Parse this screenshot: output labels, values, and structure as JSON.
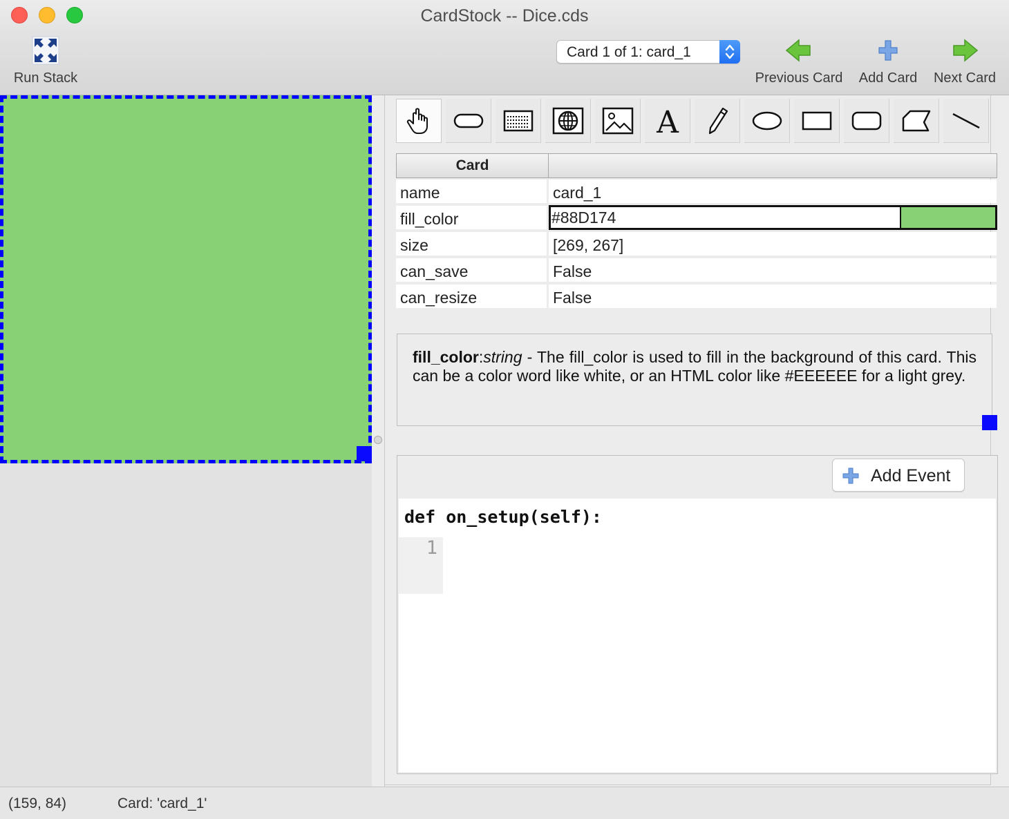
{
  "window": {
    "title": "CardStock -- Dice.cds"
  },
  "toolbar": {
    "run_stack": "Run Stack",
    "card_selector": "Card 1 of 1: card_1",
    "previous_card": "Previous Card",
    "add_card": "Add Card",
    "next_card": "Next Card"
  },
  "canvas": {
    "fill_color": "#88D174",
    "selection_color": "#0000FF"
  },
  "tools": [
    {
      "name": "hand-tool",
      "selected": true
    },
    {
      "name": "button-tool"
    },
    {
      "name": "text-field-tool"
    },
    {
      "name": "web-view-tool"
    },
    {
      "name": "image-tool"
    },
    {
      "name": "text-label-tool"
    },
    {
      "name": "pen-tool"
    },
    {
      "name": "oval-tool"
    },
    {
      "name": "rectangle-tool"
    },
    {
      "name": "rounded-rectangle-tool"
    },
    {
      "name": "polygon-tool"
    },
    {
      "name": "line-tool"
    }
  ],
  "properties": {
    "header": "Card",
    "rows": [
      {
        "key": "name",
        "value": "card_1"
      },
      {
        "key": "fill_color",
        "value": "#88D174"
      },
      {
        "key": "size",
        "value": "[269, 267]"
      },
      {
        "key": "can_save",
        "value": "False"
      },
      {
        "key": "can_resize",
        "value": "False"
      }
    ]
  },
  "help": {
    "prop_name": "fill_color",
    "separator": ":",
    "prop_type": "string",
    "text": " - The fill_color is used to fill in the background of this card. This can be a color word like white, or an HTML color like #EEEEEE for a light grey."
  },
  "events": {
    "add_event": "Add Event",
    "signature": "def on_setup(self):",
    "line_number": "1"
  },
  "status": {
    "coords": "(159, 84)",
    "card": "Card: 'card_1'"
  }
}
